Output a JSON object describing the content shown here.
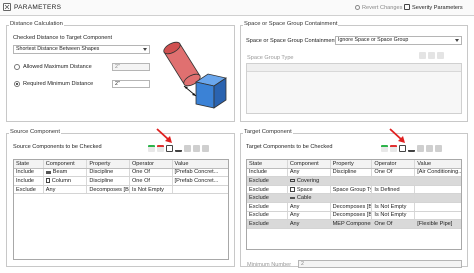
{
  "header": {
    "title": "PARAMETERS",
    "revert_label": "Revert Changes",
    "severity_label": "Severity Parameters"
  },
  "distance": {
    "section_title": "Distance Calculation",
    "checked_label": "Checked Distance to Target Component",
    "checked_value": "Shortest Distance Between Shapes",
    "allowed_label": "Allowed Maximum Distance",
    "allowed_value": "2\"",
    "required_label": "Required Minimum Distance",
    "required_value": "2\""
  },
  "space_group": {
    "section_title": "Space or Space Group Containment",
    "label": "Space or Space Group Containment",
    "value": "Ignore Space or Space Group",
    "type_label": "Space Group Type"
  },
  "source": {
    "section_title": "Source Component",
    "table_title": "Source Components to be Checked",
    "columns": [
      "State",
      "Component",
      "Property",
      "Operator",
      "Value"
    ],
    "rows": [
      {
        "state": "Include",
        "component": "Beam",
        "component_icon": "beam-icon",
        "property": "Discipline",
        "operator": "One Of",
        "value": "[Prefab Concret..."
      },
      {
        "state": "Include",
        "component": "Column",
        "component_icon": "column-icon",
        "property": "Discipline",
        "operator": "One Of",
        "value": "[Prefab Concret..."
      },
      {
        "state": "Exclude",
        "component": "Any",
        "component_icon": "",
        "property": "Decomposes [Ba...",
        "operator": "Is Not Empty",
        "value": ""
      }
    ]
  },
  "target": {
    "section_title": "Target Component",
    "table_title": "Target Components to be Checked",
    "columns": [
      "State",
      "Component",
      "Property",
      "Operator",
      "Value"
    ],
    "rows": [
      {
        "state": "Include",
        "component": "Any",
        "component_icon": "",
        "property": "Discipline",
        "operator": "One Of",
        "value": "[Air Conditioning..."
      },
      {
        "state": "Exclude",
        "component": "Covering",
        "component_icon": "covering-icon",
        "property": "",
        "operator": "",
        "value": ""
      },
      {
        "state": "Exclude",
        "component": "Space",
        "component_icon": "space-icon",
        "property": "Space Group Ty...",
        "operator": "Is Defined",
        "value": ""
      },
      {
        "state": "Exclude",
        "component": "Cable",
        "component_icon": "cable-icon",
        "property": "",
        "operator": "",
        "value": ""
      },
      {
        "state": "Exclude",
        "component": "Any",
        "component_icon": "",
        "property": "Decomposes [Ba...",
        "operator": "Is Not Empty",
        "value": ""
      },
      {
        "state": "Exclude",
        "component": "Any",
        "component_icon": "",
        "property": "Decomposes [Ba...",
        "operator": "Is Not Empty",
        "value": ""
      },
      {
        "state": "Exclude",
        "component": "Any",
        "component_icon": "",
        "property": "MEP Componen...",
        "operator": "One Of",
        "value": "[Flexible Pipe]"
      }
    ],
    "minimum_number_label": "Minimum Number",
    "minimum_number_value": "2"
  },
  "colors": {
    "annotation_arrow": "#e02020",
    "cylinder": "#e07070",
    "box": "#3b82d6",
    "selected_row": "#d9d9d9"
  }
}
